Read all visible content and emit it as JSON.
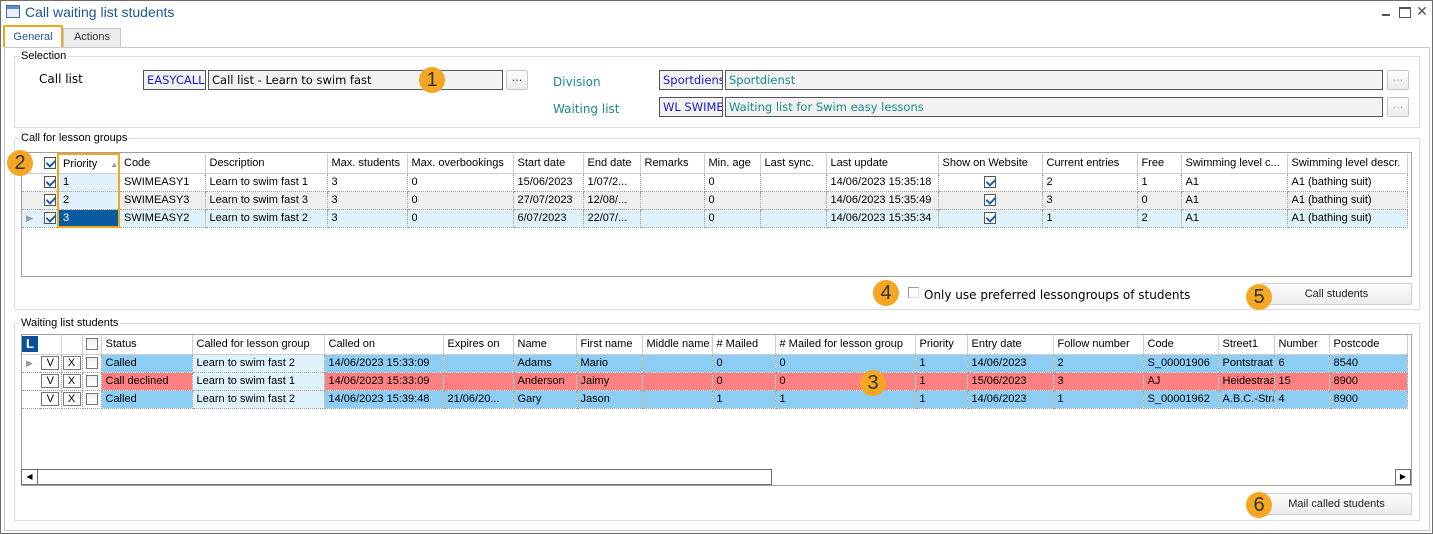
{
  "window": {
    "title": "Call waiting list students",
    "controls": {
      "minimize": "minimize",
      "maximize": "maximize",
      "close": "✕"
    }
  },
  "tabs": [
    {
      "label": "General",
      "active": true
    },
    {
      "label": "Actions",
      "active": false
    }
  ],
  "selection": {
    "legend": "Selection",
    "call_list": {
      "label": "Call list",
      "code": "EASYCALL",
      "description": "Call list - Learn to swim fast",
      "button": "..."
    },
    "division": {
      "label": "Division",
      "code": "Sportdienst",
      "description": "Sportdienst",
      "button": "..."
    },
    "waiting_list": {
      "label": "Waiting list",
      "code": "WL SWIMEASY",
      "description": "Waiting list for Swim easy lessons",
      "button": "..."
    }
  },
  "badges": [
    "1",
    "2",
    "3",
    "4",
    "5",
    "6"
  ],
  "lesson_groups": {
    "legend": "Call for lesson groups",
    "header_checked": true,
    "sort_indicator": "▲",
    "columns": [
      "Priority",
      "Code",
      "Description",
      "Max. students",
      "Max. overbookings",
      "Start date",
      "End date",
      "Remarks",
      "Min. age",
      "Last sync.",
      "Last update",
      "Show on Website",
      "Current entries",
      "Free",
      "Swimming level c...",
      "Swimming level descr."
    ],
    "rows": [
      {
        "selected": true,
        "priority": "1",
        "code": "SWIMEASY1",
        "description": "Learn to swim fast 1",
        "max_students": "3",
        "max_overbookings": "0",
        "start_date": "15/06/2023",
        "end_date": "1/07/2...",
        "remarks": "",
        "min_age": "0",
        "last_sync": "",
        "last_update": "14/06/2023 15:35:18",
        "show_on_website": true,
        "current_entries": "2",
        "free": "1",
        "level_code": "A1",
        "level_descr": "A1 (bathing suit)"
      },
      {
        "selected": true,
        "priority": "2",
        "code": "SWIMEASY3",
        "description": "Learn to swim fast 3",
        "max_students": "3",
        "max_overbookings": "0",
        "start_date": "27/07/2023",
        "end_date": "12/08/...",
        "remarks": "",
        "min_age": "0",
        "last_sync": "",
        "last_update": "14/06/2023 15:35:49",
        "show_on_website": true,
        "current_entries": "3",
        "free": "0",
        "level_code": "A1",
        "level_descr": "A1 (bathing suit)"
      },
      {
        "selected": true,
        "priority": "3",
        "code": "SWIMEASY2",
        "description": "Learn to swim fast 2",
        "max_students": "3",
        "max_overbookings": "0",
        "start_date": "6/07/2023",
        "end_date": "22/07/...",
        "remarks": "",
        "min_age": "0",
        "last_sync": "",
        "last_update": "14/06/2023 15:35:34",
        "show_on_website": true,
        "current_entries": "1",
        "free": "2",
        "level_code": "A1",
        "level_descr": "A1 (bathing suit)"
      }
    ],
    "preferred_checkbox": {
      "label": "Only use preferred lessongroups of students",
      "checked": false
    },
    "call_button": "Call students"
  },
  "waiting_students": {
    "legend": "Waiting list students",
    "layout_badge": "L",
    "columns": [
      "Status",
      "Called for lesson group",
      "Called on",
      "Expires on",
      "Name",
      "First name",
      "Middle name",
      "# Mailed",
      "# Mailed for lesson group",
      "Priority",
      "Entry date",
      "Follow number",
      "Code",
      "Street1",
      "Number",
      "Postcode"
    ],
    "accept_label": "V",
    "decline_label": "X",
    "rows": [
      {
        "status": "Called",
        "lesson_group": "Learn to swim fast 2",
        "called_on": "14/06/2023 15:33:09",
        "expires_on": "",
        "name": "Adams",
        "first_name": "Mario",
        "middle_name": "",
        "mailed": "0",
        "mailed_group": "0",
        "priority": "1",
        "entry_date": "14/06/2023",
        "follow_number": "2",
        "code": "S_00001906",
        "street": "Pontstraat",
        "number": "6",
        "postcode": "8540"
      },
      {
        "status": "Call declined",
        "lesson_group": "Learn to swim fast 1",
        "called_on": "14/06/2023 15:33:09",
        "expires_on": "",
        "name": "Anderson",
        "first_name": "Jaimy",
        "middle_name": "",
        "mailed": "0",
        "mailed_group": "0",
        "priority": "1",
        "entry_date": "15/06/2023",
        "follow_number": "3",
        "code": "AJ",
        "street": "Heidestraat",
        "number": "15",
        "postcode": "8900"
      },
      {
        "status": "Called",
        "lesson_group": "Learn to swim fast 2",
        "called_on": "14/06/2023 15:39:48",
        "expires_on": "21/06/20...",
        "name": "Gary",
        "first_name": "Jason",
        "middle_name": "",
        "mailed": "1",
        "mailed_group": "1",
        "priority": "1",
        "entry_date": "14/06/2023",
        "follow_number": "1",
        "code": "S_00001962",
        "street": "A.B.C.-Straat",
        "number": "4",
        "postcode": "8900"
      }
    ],
    "mail_button": "Mail called students",
    "scroll_left": "◀",
    "scroll_right": "▶"
  },
  "colors": {
    "accent_orange": "#f5a623",
    "called_row": "#8ccdf5",
    "declined_row": "#ff8080",
    "selected_cell": "#0a5aa0",
    "title_blue": "#1f5596"
  }
}
